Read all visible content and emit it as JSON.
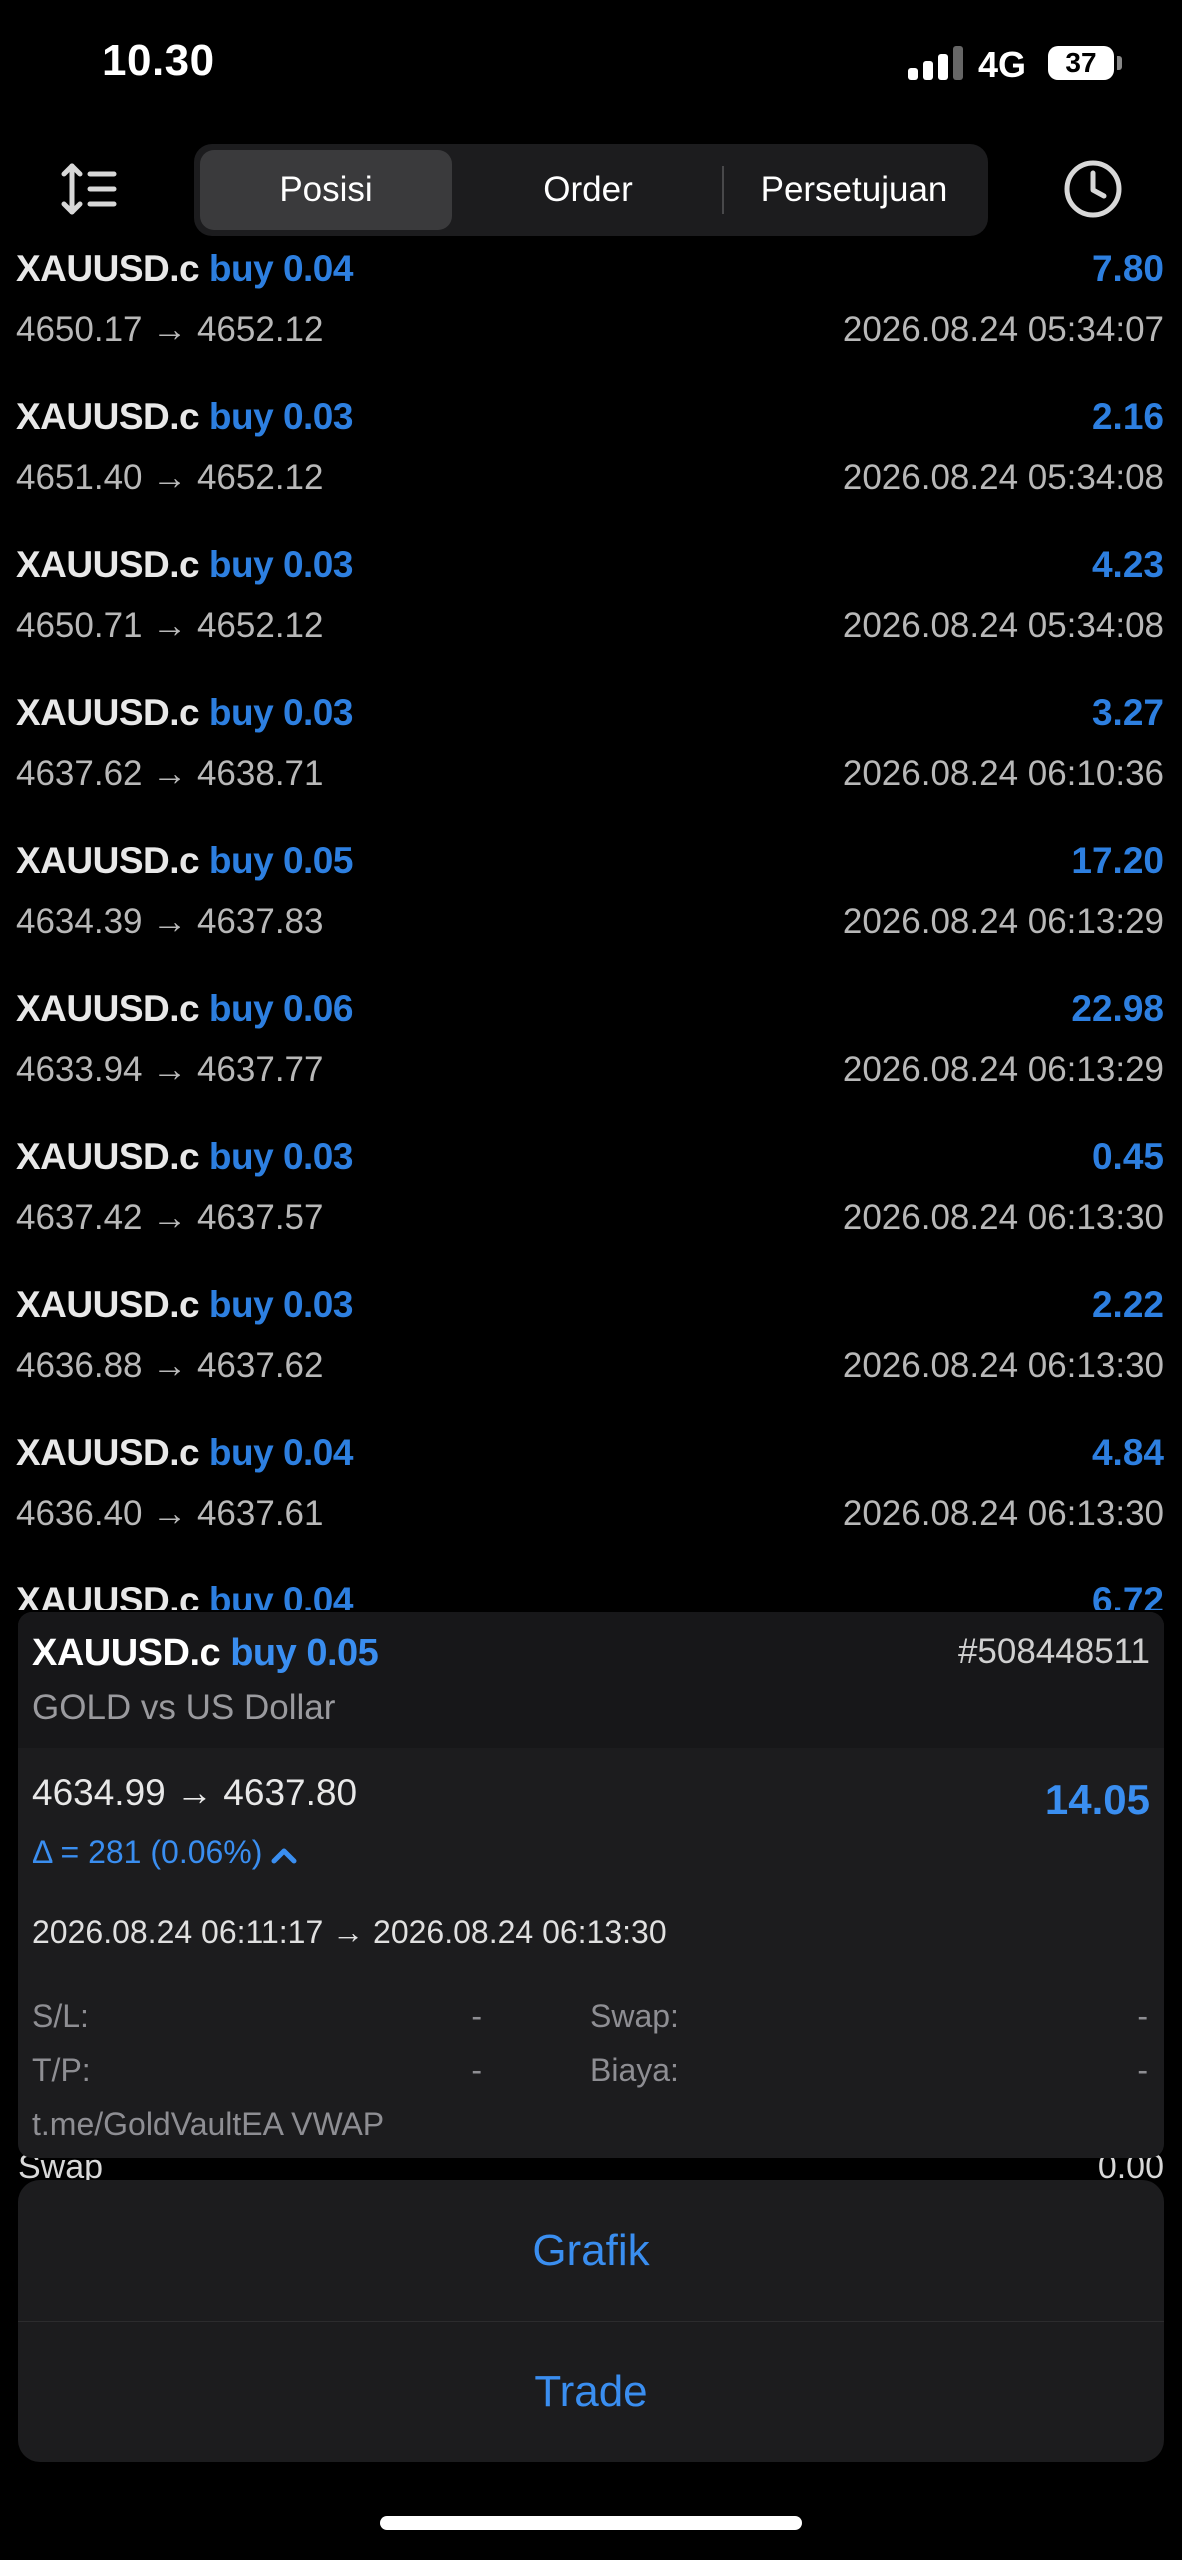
{
  "status_bar": {
    "time": "10.30",
    "network": "4G",
    "battery": "37"
  },
  "tabs": [
    {
      "label": "Posisi",
      "active": true
    },
    {
      "label": "Order",
      "active": false
    },
    {
      "label": "Persetujuan",
      "active": false
    }
  ],
  "positions": [
    {
      "symbol": "XAUUSD.c",
      "direction": "buy 0.04",
      "profit": "7.80",
      "prices": "4650.17 → 4652.12",
      "time": "2026.08.24 05:34:07"
    },
    {
      "symbol": "XAUUSD.c",
      "direction": "buy 0.03",
      "profit": "2.16",
      "prices": "4651.40 → 4652.12",
      "time": "2026.08.24 05:34:08"
    },
    {
      "symbol": "XAUUSD.c",
      "direction": "buy 0.03",
      "profit": "4.23",
      "prices": "4650.71 → 4652.12",
      "time": "2026.08.24 05:34:08"
    },
    {
      "symbol": "XAUUSD.c",
      "direction": "buy 0.03",
      "profit": "3.27",
      "prices": "4637.62 → 4638.71",
      "time": "2026.08.24 06:10:36"
    },
    {
      "symbol": "XAUUSD.c",
      "direction": "buy 0.05",
      "profit": "17.20",
      "prices": "4634.39 → 4637.83",
      "time": "2026.08.24 06:13:29"
    },
    {
      "symbol": "XAUUSD.c",
      "direction": "buy 0.06",
      "profit": "22.98",
      "prices": "4633.94 → 4637.77",
      "time": "2026.08.24 06:13:29"
    },
    {
      "symbol": "XAUUSD.c",
      "direction": "buy 0.03",
      "profit": "0.45",
      "prices": "4637.42 → 4637.57",
      "time": "2026.08.24 06:13:30"
    },
    {
      "symbol": "XAUUSD.c",
      "direction": "buy 0.03",
      "profit": "2.22",
      "prices": "4636.88 → 4637.62",
      "time": "2026.08.24 06:13:30"
    },
    {
      "symbol": "XAUUSD.c",
      "direction": "buy 0.04",
      "profit": "4.84",
      "prices": "4636.40 → 4637.61",
      "time": "2026.08.24 06:13:30"
    },
    {
      "symbol": "XAUUSD.c",
      "direction": "buy 0.04",
      "profit": "6.72",
      "prices": "",
      "time": ""
    }
  ],
  "detail": {
    "symbol": "XAUUSD.c",
    "direction": "buy 0.05",
    "ticket": "#508448511",
    "description": "GOLD vs US Dollar",
    "prices": "4634.99 → 4637.80",
    "profit": "14.05",
    "delta": "Δ = 281 (0.06%)",
    "times": "2026.08.24 06:11:17 → 2026.08.24 06:13:30",
    "sl_label": "S/L:",
    "sl_value": "-",
    "tp_label": "T/P:",
    "tp_value": "-",
    "swap_label": "Swap:",
    "swap_value": "-",
    "fee_label": "Biaya:",
    "fee_value": "-",
    "comment": "t.me/GoldVaultEA VWAP"
  },
  "summary_peek": {
    "label": "Swap",
    "value": "0.00"
  },
  "actions": {
    "chart": "Grafik",
    "trade": "Trade"
  }
}
